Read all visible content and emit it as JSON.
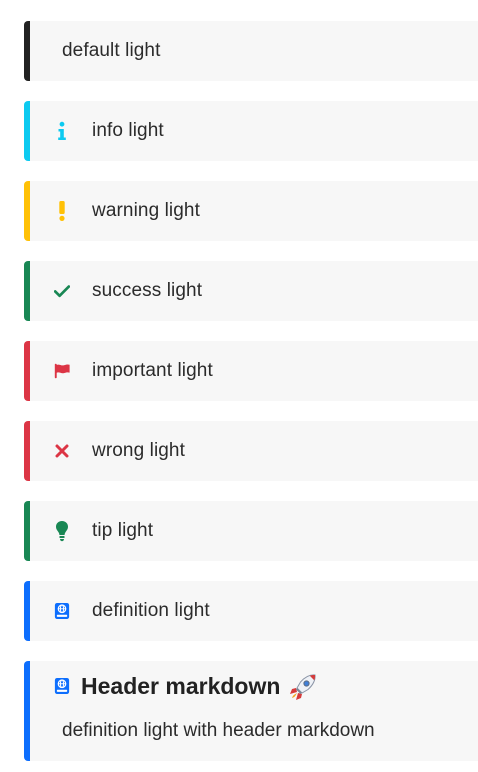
{
  "callouts": [
    {
      "variant": "default",
      "label": "default light",
      "color": "#222222",
      "icon": null
    },
    {
      "variant": "info",
      "label": "info light",
      "color": "#0dcaf0",
      "icon": "info-icon"
    },
    {
      "variant": "warning",
      "label": "warning light",
      "color": "#ffc107",
      "icon": "exclamation-icon"
    },
    {
      "variant": "success",
      "label": "success light",
      "color": "#198754",
      "icon": "check-icon"
    },
    {
      "variant": "important",
      "label": "important light",
      "color": "#dc3545",
      "icon": "flag-icon"
    },
    {
      "variant": "wrong",
      "label": "wrong light",
      "color": "#dc3545",
      "icon": "x-icon"
    },
    {
      "variant": "tip",
      "label": "tip light",
      "color": "#198754",
      "icon": "lightbulb-icon"
    },
    {
      "variant": "definition",
      "label": "definition light",
      "color": "#0d6efd",
      "icon": "book-icon"
    }
  ],
  "header_callout": {
    "title": "Header markdown",
    "title_emoji": "rocket-icon",
    "body": "definition light with header markdown",
    "color": "#0d6efd",
    "icon": "book-icon"
  }
}
